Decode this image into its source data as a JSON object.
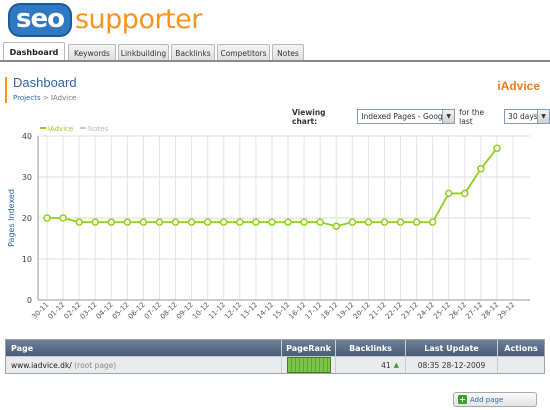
{
  "logo": {
    "part1": "seo",
    "part2": "supporter"
  },
  "tabs": [
    {
      "label": "Dashboard",
      "active": true
    },
    {
      "label": "Keywords"
    },
    {
      "label": "Linkbuilding"
    },
    {
      "label": "Backlinks"
    },
    {
      "label": "Competitors"
    },
    {
      "label": "Notes"
    }
  ],
  "page": {
    "title": "Dashboard",
    "breadcrumb_projects": "Projects",
    "breadcrumb_sep": " > ",
    "breadcrumb_current": "IAdvice",
    "project_name": "iAdvice"
  },
  "viewbar": {
    "label": "Viewing chart:",
    "chart_select": "Indexed Pages - Google",
    "for_last": "for the last",
    "range_select": "30 days"
  },
  "chart_data": {
    "type": "line",
    "ylabel": "Pages Indexed",
    "ylim": [
      0,
      40
    ],
    "yticks": [
      0,
      10,
      20,
      30,
      40
    ],
    "grid": true,
    "legend_position": "top-left",
    "series": [
      {
        "name": "iAdvice",
        "color": "#8fd11a",
        "values": [
          20,
          20,
          19,
          19,
          19,
          19,
          19,
          19,
          19,
          19,
          19,
          19,
          19,
          19,
          19,
          19,
          19,
          19,
          18,
          19,
          19,
          19,
          19,
          19,
          19,
          26,
          26,
          32,
          37,
          null
        ]
      },
      {
        "name": "Notes",
        "color": "#cccccc",
        "values": []
      }
    ],
    "categories": [
      "30-11",
      "01-12",
      "02-12",
      "03-12",
      "04-12",
      "05-12",
      "06-12",
      "07-12",
      "08-12",
      "09-12",
      "10-12",
      "11-12",
      "12-12",
      "13-12",
      "14-12",
      "15-12",
      "16-12",
      "17-12",
      "18-12",
      "19-12",
      "20-12",
      "21-12",
      "22-12",
      "23-12",
      "24-12",
      "25-12",
      "26-12",
      "27-12",
      "28-12",
      "29-12"
    ]
  },
  "table": {
    "headers": {
      "page": "Page",
      "pagerank": "PageRank",
      "backlinks": "Backlinks",
      "last_update": "Last Update",
      "actions": "Actions"
    },
    "rows": [
      {
        "url": "www.iadvice.dk/",
        "note": "(root page)",
        "pagerank": 10,
        "backlinks": "41",
        "last_update": "08:35 28-12-2009"
      }
    ]
  },
  "add_page_label": "Add page",
  "icons": {
    "add": "plus-icon",
    "trend": "arrow-up-icon",
    "dropdown": "chevron-down-icon"
  }
}
